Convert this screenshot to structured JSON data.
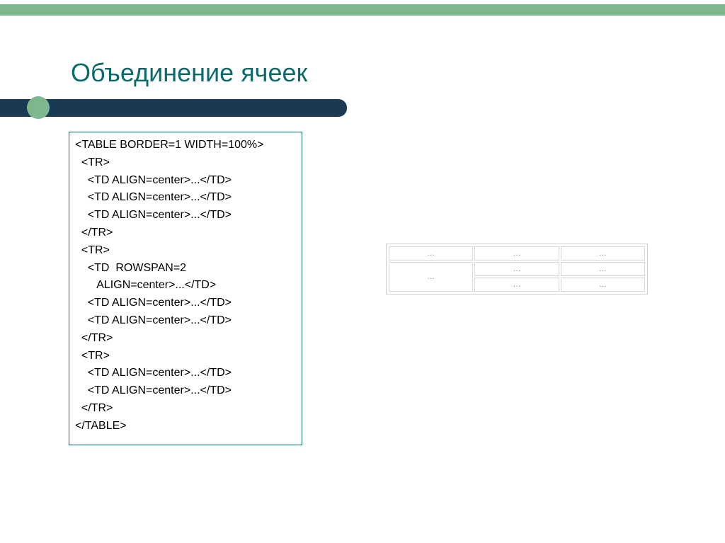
{
  "title": "Объединение ячеек",
  "code_lines": [
    "<TABLE BORDER=1 WIDTH=100%>",
    "  <TR>",
    "    <TD ALIGN=center>...</TD>",
    "    <TD ALIGN=center>...</TD>",
    "    <TD ALIGN=center>...</TD>",
    "  </TR>",
    "  <TR>",
    "    <TD  ROWSPAN=2",
    "       ALIGN=center>...</TD>",
    "    <TD ALIGN=center>...</TD>",
    "    <TD ALIGN=center>...</TD>",
    "  </TR>",
    "  <TR>",
    "    <TD ALIGN=center>...</TD>",
    "    <TD ALIGN=center>...</TD>",
    "  </TR>",
    "</TABLE>"
  ],
  "cell_content": "…"
}
